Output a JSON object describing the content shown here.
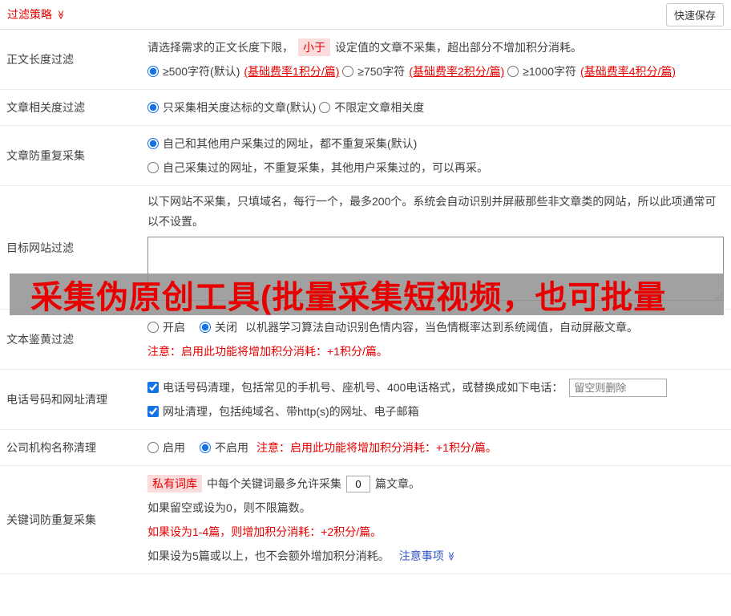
{
  "header": {
    "title": "过滤策略",
    "arrow": "≫",
    "save_button": "快速保存"
  },
  "banner": {
    "text": "采集伪原创工具(批量采集短视频，也可批量"
  },
  "sections": {
    "length": {
      "label": "正文长度过滤",
      "intro_before": "请选择需求的正文长度下限，",
      "intro_tag": "小于",
      "intro_after": "设定值的文章不采集，超出部分不增加积分消耗。",
      "options": [
        {
          "text": "≥500字符(默认)",
          "note": "(基础费率1积分/篇)",
          "checked": true
        },
        {
          "text": "≥750字符",
          "note": "(基础费率2积分/篇)",
          "checked": false
        },
        {
          "text": "≥1000字符",
          "note": "(基础费率4积分/篇)",
          "checked": false
        }
      ]
    },
    "relevance": {
      "label": "文章相关度过滤",
      "options": [
        {
          "text": "只采集相关度达标的文章(默认)",
          "checked": true
        },
        {
          "text": "不限定文章相关度",
          "checked": false
        }
      ]
    },
    "dedupe": {
      "label": "文章防重复采集",
      "options": [
        {
          "text": "自己和其他用户采集过的网址，都不重复采集(默认)",
          "checked": true
        },
        {
          "text": "自己采集过的网址，不重复采集，其他用户采集过的，可以再采。",
          "checked": false
        }
      ]
    },
    "target_site": {
      "label": "目标网站过滤",
      "intro": "以下网站不采集，只填域名，每行一个，最多200个。系统会自动识别并屏蔽那些非文章类的网站，所以此项通常可以不设置。",
      "textarea_value": ""
    },
    "porn_filter": {
      "label": "文本鉴黄过滤",
      "options": [
        {
          "text": "开启",
          "checked": false
        },
        {
          "text": "关闭",
          "checked": true
        }
      ],
      "description": "以机器学习算法自动识别色情内容，当色情概率达到系统阈值，自动屏蔽文章。",
      "warning": "注意：启用此功能将增加积分消耗：+1积分/篇。"
    },
    "phone_url": {
      "label": "电话号码和网址清理",
      "phone_option": {
        "text": "电话号码清理，包括常见的手机号、座机号、400电话格式，或替换成如下电话：",
        "checked": true
      },
      "phone_placeholder": "留空则删除",
      "url_option": {
        "text": "网址清理，包括纯域名、带http(s)的网址、电子邮箱",
        "checked": true
      }
    },
    "company": {
      "label": "公司机构名称清理",
      "options": [
        {
          "text": "启用",
          "checked": false
        },
        {
          "text": "不启用",
          "checked": true
        }
      ],
      "warning": "注意：启用此功能将增加积分消耗：+1积分/篇。"
    },
    "keyword": {
      "label": "关键词防重复采集",
      "line1_tag": "私有词库",
      "line1_mid": "中每个关键词最多允许采集",
      "count_value": "0",
      "line1_end": "篇文章。",
      "line2": "如果留空或设为0，则不限篇数。",
      "line3": "如果设为1-4篇，则增加积分消耗：+2积分/篇。",
      "line4": "如果设为5篇或以上，也不会额外增加积分消耗。",
      "link": "注意事项",
      "link_arrow": "≫"
    }
  },
  "colors": {
    "accent_red": "#e80000",
    "highlight_pink": "#fbdcdc",
    "link_blue": "#3355cc",
    "control_blue": "#1673e6"
  }
}
